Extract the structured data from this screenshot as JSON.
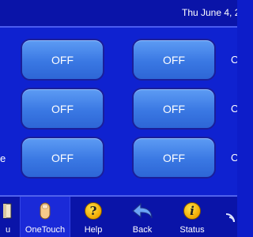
{
  "header": {
    "datetime": "Thu June 4, 2"
  },
  "zones": [
    {
      "left_label": "OFF",
      "right_label": "OFF",
      "right_edge": "O"
    },
    {
      "left_label": "OFF",
      "right_label": "OFF",
      "right_edge": "O"
    },
    {
      "left_label": "OFF",
      "right_label": "OFF",
      "right_edge": "O",
      "left_edge": "e"
    }
  ],
  "toolbar": {
    "menu_label": "u",
    "onetouch_label": "OneTouch",
    "help_label": "Help",
    "back_label": "Back",
    "status_label": "Status",
    "help_glyph": "?",
    "status_glyph": "i"
  },
  "colors": {
    "background": "#0f22d0",
    "button": "#3a78e3",
    "icon_yellow": "#f0a800"
  }
}
